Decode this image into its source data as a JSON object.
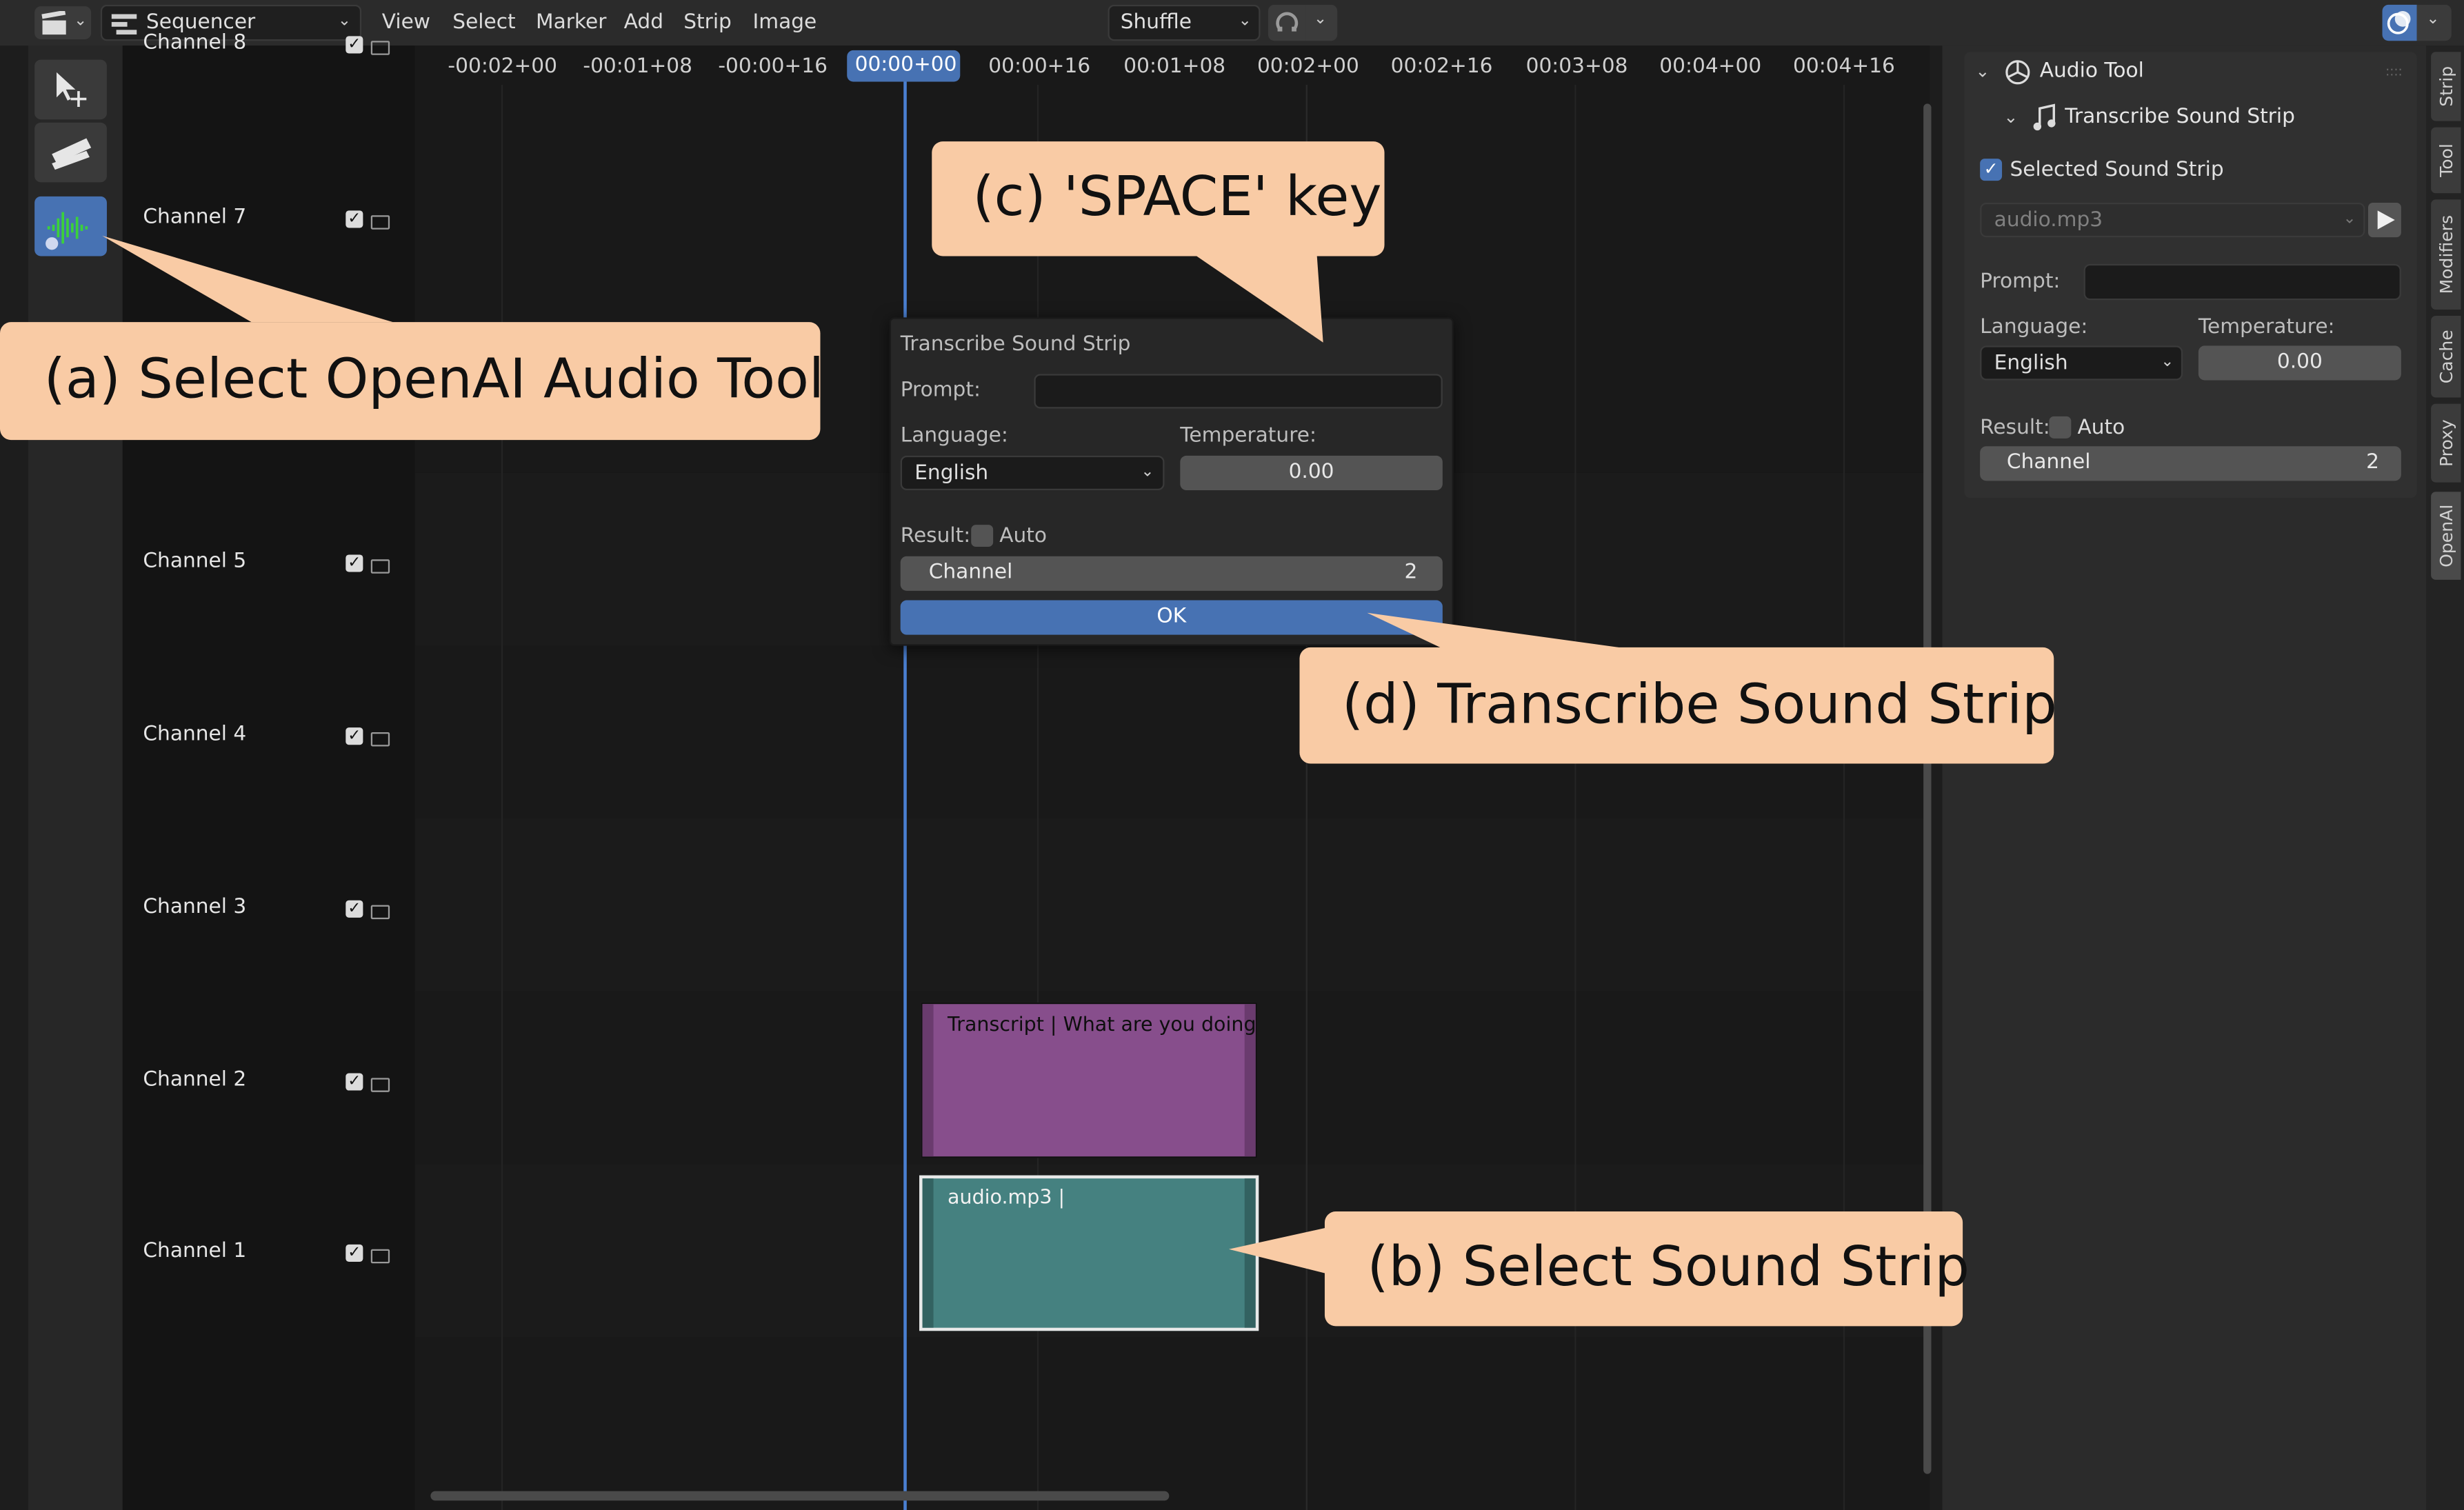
{
  "topbar": {
    "editor_type": "Sequencer",
    "menus": [
      "View",
      "Select",
      "Marker",
      "Add",
      "Strip",
      "Image"
    ],
    "snap_mode": "Shuffle"
  },
  "timeline": {
    "ticks": [
      "-00:02+00",
      "-00:01+08",
      "-00:00+16",
      "00:00+00",
      "00:00+16",
      "00:01+08",
      "00:02+00",
      "00:02+16",
      "00:03+08",
      "00:04+00",
      "00:04+16"
    ],
    "current_frame": "00:00+00"
  },
  "channels": [
    "Channel 8",
    "Channel 7",
    "Channel 5",
    "Channel 4",
    "Channel 3",
    "Channel 2",
    "Channel 1"
  ],
  "strips": {
    "transcript": "Transcript | What are you doing",
    "audio": "audio.mp3 |"
  },
  "popup": {
    "title": "Transcribe Sound Strip",
    "prompt_label": "Prompt:",
    "language_label": "Language:",
    "language_value": "English",
    "temperature_label": "Temperature:",
    "temperature_value": "0.00",
    "result_label": "Result:",
    "auto_label": "Auto",
    "channel_label": "Channel",
    "channel_value": "2",
    "ok_label": "OK"
  },
  "panel": {
    "header": "Audio Tool",
    "subheader": "Transcribe Sound Strip",
    "selected_label": "Selected Sound Strip",
    "sound_strip": "audio.mp3",
    "prompt_label": "Prompt:",
    "language_label": "Language:",
    "language_value": "English",
    "temperature_label": "Temperature:",
    "temperature_value": "0.00",
    "result_label": "Result:",
    "auto_label": "Auto",
    "channel_label": "Channel",
    "channel_value": "2"
  },
  "side_tabs": [
    "Strip",
    "Tool",
    "Modifiers",
    "Cache",
    "Proxy",
    "OpenAI"
  ],
  "callouts": {
    "a": "(a) Select OpenAI Audio Tool",
    "b": "(b) Select Sound Strip",
    "c": "(c) 'SPACE' key",
    "d": "(d) Transcribe Sound Strip"
  },
  "colors": {
    "accent_blue": "#4772b3",
    "callout": "#f9cba5",
    "transcript_strip": "#874e8c",
    "audio_strip": "#458180",
    "playhead": "#4a7fd1"
  },
  "icons": [
    "clapperboard-icon",
    "sequencer-icon",
    "move-tool-icon",
    "blade-tool-icon",
    "audio-waveform-icon",
    "snap-icon",
    "overlay-icon",
    "openai-icon",
    "music-note-icon",
    "play-icon"
  ]
}
